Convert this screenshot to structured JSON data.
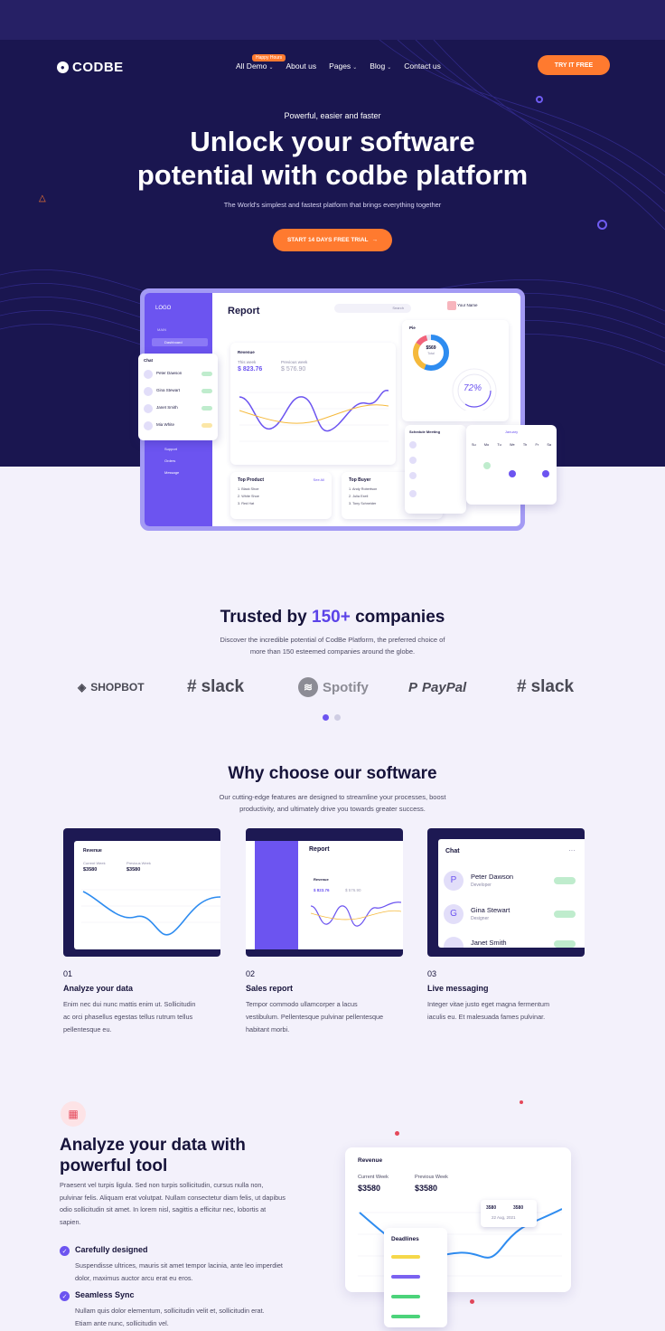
{
  "nav": {
    "logo_text": "CODBE",
    "items": [
      {
        "label": "All Demo",
        "dropdown": true,
        "badge": "Happy Hours"
      },
      {
        "label": "About us",
        "dropdown": false
      },
      {
        "label": "Pages",
        "dropdown": true
      },
      {
        "label": "Blog",
        "dropdown": true
      },
      {
        "label": "Contact us",
        "dropdown": false
      }
    ],
    "cta": "TRY IT FREE"
  },
  "hero": {
    "kicker": "Powerful, easier and faster",
    "title_line1": "Unlock your software",
    "title_line2": "potential with codbe platform",
    "subtitle": "The World's simplest and fastest platform that brings everything together",
    "cta": "START 14 DAYS FREE TRIAL",
    "cta_icon": "arrow-right-icon"
  },
  "dashboard": {
    "logo": "LOGO",
    "title": "Report",
    "search_placeholder": "Search",
    "user_name": "Your Name",
    "sidebar_section": "MAIN",
    "sidebar_items": [
      "Dashboard",
      "Support",
      "Orders",
      "Message"
    ],
    "revenue": {
      "label": "Revenue",
      "this_week_label": "This week",
      "this_week": "$ 823.76",
      "prev_week_label": "Previous week",
      "prev_week": "$ 576.90"
    },
    "pie": {
      "label": "Pie",
      "center_value": "$569",
      "center_label": "Total",
      "percent_label": "72%"
    },
    "top_product": {
      "label": "Top Product",
      "link": "See All",
      "rows": [
        "1. Black Shoe",
        "2. White Shoe",
        "3. Red Hat"
      ]
    },
    "top_buyer": {
      "label": "Top Buyer",
      "rows": [
        "1. Andy Robertson",
        "2. Julia Exell",
        "3. Tony Schneider"
      ]
    },
    "chat": {
      "label": "Chat",
      "people": [
        "Peter Dawson",
        "Gina Stewart",
        "Janet Smith",
        "Mia White"
      ]
    },
    "schedule": {
      "label": "Schedule Meeting"
    },
    "calendar": {
      "month": "January",
      "days": [
        "Su",
        "Mo",
        "Tu",
        "We",
        "Th",
        "Fr",
        "Sa"
      ]
    }
  },
  "trusted": {
    "title_pre": "Trusted by ",
    "title_accent": "150+",
    "title_post": " companies",
    "sub_line1": "Discover the incredible potential of CodBe Platform, the preferred choice of",
    "sub_line2": "more than 150 esteemed companies around the globe.",
    "brands": [
      "SHOPBOT",
      "slack",
      "Spotify",
      "PayPal",
      "slack"
    ]
  },
  "why": {
    "title": "Why choose our software",
    "sub_line1": "Our cutting-edge features are designed to streamline your processes, boost",
    "sub_line2": "productivity, and ultimately drive you towards greater success.",
    "features": [
      {
        "num": "01",
        "title": "Analyze your data",
        "desc": "Enim nec dui nunc mattis enim ut. Sollicitudin ac orci phasellus egestas tellus rutrum tellus pellentesque eu.",
        "shot_label": "Revenue",
        "a_label": "Current Week",
        "a": "$3580",
        "b_label": "Previous Week",
        "b": "$3580"
      },
      {
        "num": "02",
        "title": "Sales report",
        "desc": "Tempor commodo ullamcorper a lacus vestibulum. Pellentesque pulvinar pellentesque habitant morbi.",
        "shot_label": "Report",
        "a_label": "Revenue",
        "a": "$ 823.76",
        "b": "$ 576.90"
      },
      {
        "num": "03",
        "title": "Live messaging",
        "desc": "Integer vitae justo eget magna fermentum iaculis eu. Et malesuada fames pulvinar.",
        "shot_label": "Chat",
        "people": [
          {
            "name": "Peter Dawson",
            "role": "Developer"
          },
          {
            "name": "Gina Stewart",
            "role": "Designer"
          },
          {
            "name": "Janet Smith",
            "role": ""
          }
        ]
      }
    ]
  },
  "analyze": {
    "icon": "chart-icon",
    "title_line1": "Analyze your data with",
    "title_line2": "powerful tool",
    "body": "Praesent vel turpis ligula. Sed non turpis sollicitudin, cursus nulla non, pulvinar felis. Aliquam erat volutpat. Nullam consectetur diam felis, ut dapibus odio sollicitudin sit amet. In lorem nisl, sagittis a efficitur nec, lobortis at sapien.",
    "checks": [
      {
        "title": "Carefully designed",
        "desc": "Suspendisse ultrices, mauris sit amet tempor lacinia, ante leo imperdiet dolor, maximus auctor arcu erat eu eros."
      },
      {
        "title": "Seamless Sync",
        "desc": "Nullam quis dolor elementum, sollicitudin velit et, sollicitudin erat. Etiam ante nunc, sollicitudin vel."
      }
    ],
    "card": {
      "title": "Revenue",
      "a_label": "Current Week",
      "a": "$3580",
      "b_label": "Previous Week",
      "b": "$3580",
      "tooltip_a": "3580",
      "tooltip_b": "3580",
      "tooltip_date": "22 Aug, 2021",
      "deadlines_label": "Deadlines"
    }
  },
  "colors": {
    "hero_bg": "#1a1650",
    "accent_orange": "#ff7a2f",
    "accent_purple": "#6c54f0",
    "page_bg": "#f3f1fb"
  }
}
